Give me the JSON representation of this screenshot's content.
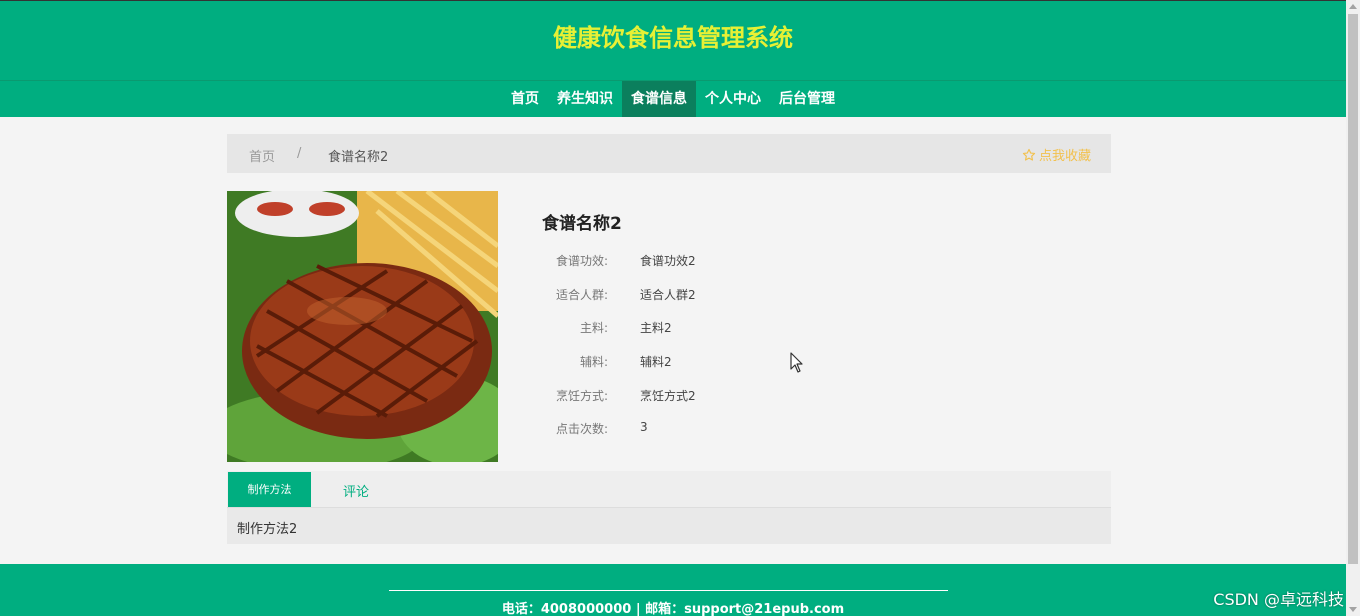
{
  "header": {
    "title": "健康饮食信息管理系统"
  },
  "nav": {
    "items": [
      {
        "label": "首页",
        "active": false
      },
      {
        "label": "养生知识",
        "active": false
      },
      {
        "label": "食谱信息",
        "active": true
      },
      {
        "label": "个人中心",
        "active": false
      },
      {
        "label": "后台管理",
        "active": false
      }
    ]
  },
  "breadcrumb": {
    "home": "首页",
    "separator": "/",
    "current": "食谱名称2"
  },
  "favorite": {
    "label": "点我收藏",
    "icon": "star-outline-icon"
  },
  "recipe": {
    "name": "食谱名称2",
    "fields": [
      {
        "label": "食谱功效:",
        "value": "食谱功效2"
      },
      {
        "label": "适合人群:",
        "value": "适合人群2"
      },
      {
        "label": "主料:",
        "value": "主料2"
      },
      {
        "label": "辅料:",
        "value": "辅料2"
      },
      {
        "label": "烹饪方式:",
        "value": "烹饪方式2"
      },
      {
        "label": "点击次数:",
        "value": "3"
      }
    ]
  },
  "tabs": {
    "method_label": "制作方法",
    "comment_label": "评论",
    "content": "制作方法2"
  },
  "footer": {
    "contact": "电话：4008000000 | 邮箱：support@21epub.com"
  },
  "watermark": "CSDN @卓远科技",
  "colors": {
    "primary": "#00ae80",
    "title": "#e7f035",
    "favorite": "#f2c14e"
  }
}
